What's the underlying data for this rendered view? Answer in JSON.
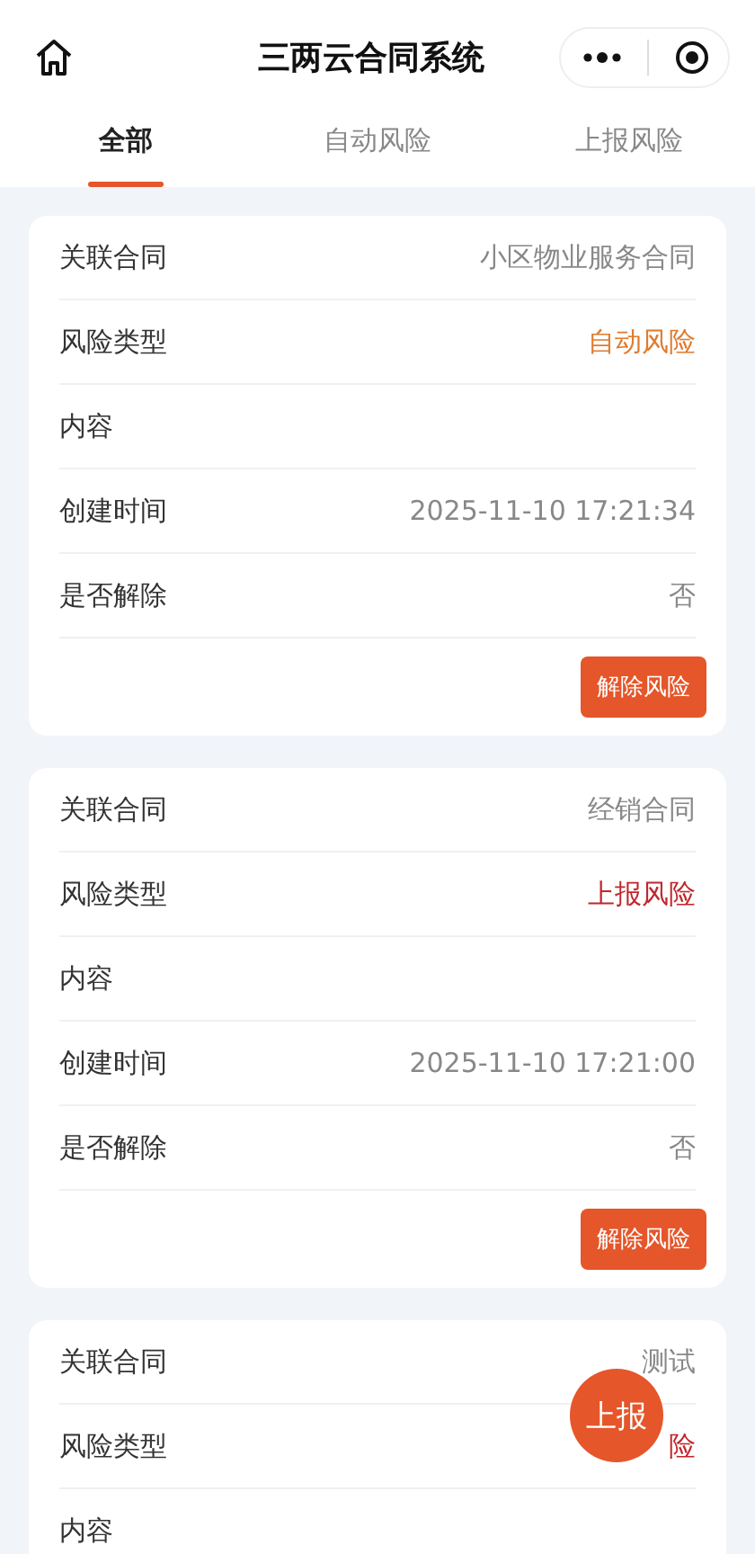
{
  "title": "三两云合同系统",
  "tabs": [
    {
      "label": "全部",
      "selected": true
    },
    {
      "label": "自动风险",
      "selected": false
    },
    {
      "label": "上报风险",
      "selected": false
    }
  ],
  "cards": [
    {
      "fields": [
        {
          "label": "关联合同",
          "value": "小区物业服务合同",
          "kind": "plain"
        },
        {
          "label": "风险类型",
          "value": "自动风险",
          "kind": "auto"
        },
        {
          "label": "内容"
        },
        {
          "label": "创建时间",
          "value": "2025-11-10 17:21:34",
          "kind": "plain"
        },
        {
          "label": "是否解除",
          "value": "否",
          "kind": "plain"
        }
      ],
      "button": "解除风险"
    },
    {
      "fields": [
        {
          "label": "关联合同",
          "value": "经销合同",
          "kind": "plain"
        },
        {
          "label": "风险类型",
          "value": "上报风险",
          "kind": "report"
        },
        {
          "label": "内容"
        },
        {
          "label": "创建时间",
          "value": "2025-11-10 17:21:00",
          "kind": "plain"
        },
        {
          "label": "是否解除",
          "value": "否",
          "kind": "plain"
        }
      ],
      "button": "解除风险"
    },
    {
      "fields": [
        {
          "label": "关联合同",
          "value": "测试",
          "kind": "plain"
        },
        {
          "label": "风险类型",
          "value": "险",
          "kind": "report"
        },
        {
          "label": "内容"
        }
      ]
    }
  ],
  "fab": "上报"
}
